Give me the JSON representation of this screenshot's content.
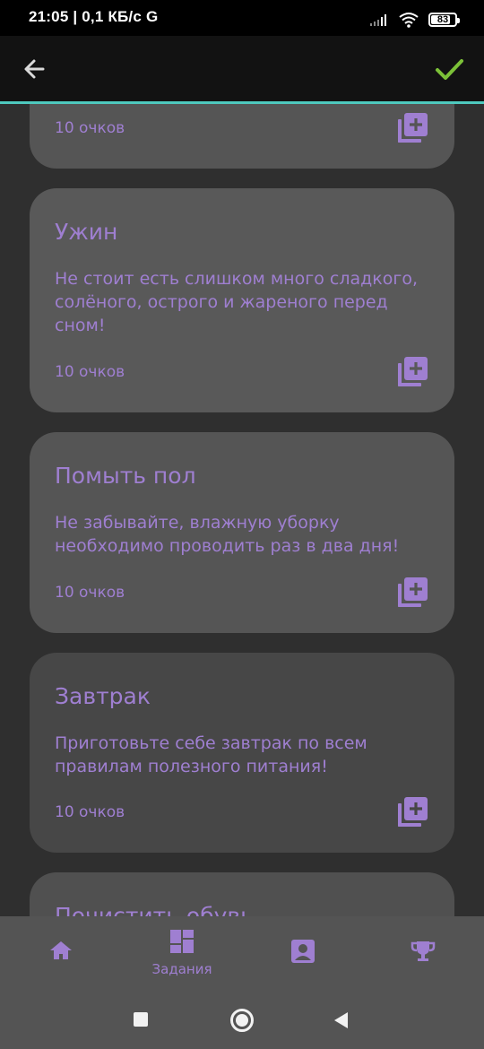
{
  "status_bar": {
    "time_speed": "21:05 | 0,1 КБ/с",
    "g_label": "G",
    "battery_percent": "83",
    "battery_level": 0.83
  },
  "app_bar": {
    "accent_line_color": "#4ec9be",
    "check_color": "#7cc138"
  },
  "tasks": [
    {
      "title": "",
      "description": "",
      "points": "10 очков"
    },
    {
      "title": "Ужин",
      "description": "Не стоит есть слишком много сладкого, солёного, острого и жареного перед сном!",
      "points": "10 очков"
    },
    {
      "title": "Помыть пол",
      "description": "Не забывайте, влажную уборку необходимо проводить раз в два дня!",
      "points": "10 очков"
    },
    {
      "title": "Завтрак",
      "description": "Приготовьте себе завтрак по всем правилам полезного питания!",
      "points": "10 очков"
    },
    {
      "title": "Почистить обувь",
      "description": "",
      "points": ""
    }
  ],
  "bottom_nav": {
    "tasks_label": "Задания",
    "items": [
      "home-icon",
      "dashboard-icon",
      "profile-icon",
      "trophy-icon"
    ]
  },
  "colors": {
    "accent_purple": "#9f7fd1",
    "background": "#2f2f2f"
  }
}
